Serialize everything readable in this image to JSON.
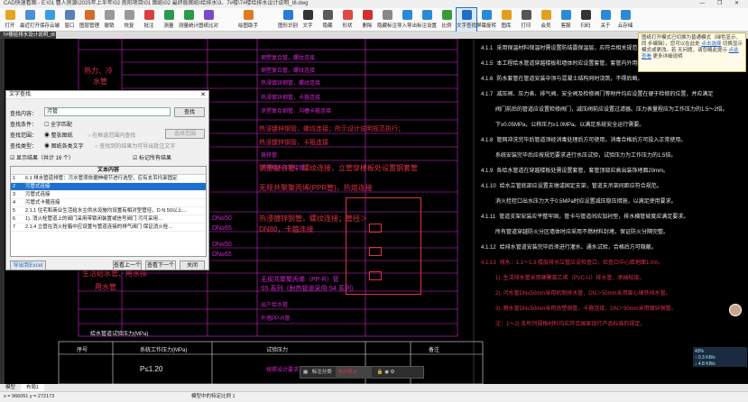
{
  "window": {
    "title": "CAD快速看图 - E:\\01 曹人房源\\2025年上半年\\02 南阳项目\\01 图纸\\02 最终版图纸\\给排水\\3、7#楼\\7#楼给排水设计说明_t8.dwg",
    "controls": "— ❐ ✕"
  },
  "ribbon": {
    "items": [
      {
        "label": "打开",
        "icon": "open-folder-icon",
        "color": "#e6a422"
      },
      {
        "label": "最近打开",
        "icon": "recent-icon",
        "color": "#4a8fd8"
      },
      {
        "label": "保存云端",
        "icon": "cloud-save-icon",
        "color": "#3a9de0"
      },
      {
        "label": "窗口",
        "icon": "window-icon",
        "color": "#5a7fb8"
      },
      {
        "label": "图层管理",
        "icon": "layers-icon",
        "color": "#d66a2a"
      },
      {
        "label": "撤销",
        "icon": "undo-icon",
        "color": "#999999"
      },
      {
        "label": "恢复",
        "icon": "redo-icon",
        "color": "#999999"
      },
      {
        "label": "批注",
        "icon": "annotate-icon",
        "color": "#d84040"
      },
      {
        "label": "测量",
        "icon": "measure-icon",
        "color": "#2b9a4a"
      },
      {
        "label": "测量统计",
        "icon": "measure-stat-icon",
        "color": "#2b9a4a"
      },
      {
        "label": "图纸比对",
        "icon": "compare-icon",
        "color": "#7a4ac8"
      },
      {
        "label": "",
        "icon": "",
        "color": "#fafafa"
      },
      {
        "label": "绘图助手",
        "icon": "draw-helper-icon",
        "color": "#e07a20"
      },
      {
        "label": "",
        "icon": "",
        "color": "#fafafa"
      },
      {
        "label": "图形识别",
        "icon": "recognize-icon",
        "color": "#2a7ad8"
      },
      {
        "label": "文字",
        "icon": "text-icon",
        "color": "#333333"
      },
      {
        "label": "隐藏",
        "icon": "hide-icon",
        "color": "#5a5a5a"
      },
      {
        "label": "形状",
        "icon": "shape-icon",
        "color": "#e04848"
      },
      {
        "label": "删除",
        "icon": "delete-icon",
        "color": "#d03030"
      },
      {
        "label": "隐藏标注",
        "icon": "hide-mark-icon",
        "color": "#888888"
      },
      {
        "label": "导入导出",
        "icon": "import-export-icon",
        "color": "#2a8ad8"
      },
      {
        "label": "标注设置",
        "icon": "mark-settings-icon",
        "color": "#2a8ad8"
      },
      {
        "label": "比例",
        "icon": "scale-icon",
        "color": "#3a9a3a"
      },
      {
        "label": "文字查找",
        "icon": "text-search-icon",
        "color": "#1e6ec8"
      },
      {
        "label": "屏幕旋转",
        "icon": "rotate-icon",
        "color": "#2a8ad8"
      },
      {
        "label": "图库",
        "icon": "library-icon",
        "color": "#e0a020"
      },
      {
        "label": "打印",
        "icon": "print-icon",
        "color": "#555555"
      },
      {
        "label": "会员",
        "icon": "vip-icon",
        "color": "#e0a020"
      },
      {
        "label": "客服",
        "icon": "service-icon",
        "color": "#2a8ad8"
      },
      {
        "label": "扫码",
        "icon": "qr-icon",
        "color": "#333333"
      },
      {
        "label": "关于",
        "icon": "about-icon",
        "color": "#2a8ad8"
      },
      {
        "label": "云存储",
        "icon": "cloud-icon",
        "color": "#2a8ad8"
      }
    ]
  },
  "doc_tab": "7#楼给排水设计说明_t8",
  "tooltip": {
    "line1": "图纸打开模式已切换为普通模式（绿色显示、同",
    "line2": "步编辑），您可以在此处",
    "link1": "点击选择",
    "line3": "切换显示模式或更改。若",
    "line4": "无问题，请忽略此提示",
    "link2": "点此查看",
    "line5": "更多详细说明"
  },
  "dialog": {
    "title": "文字查找",
    "search_label": "查找内容：",
    "search_value": "污管",
    "search_button": "查找",
    "condition_label": "查找条件：",
    "whole_match": "全字匹配",
    "scope_label": "查找范围：",
    "scope_all": "整张图纸",
    "scope_select": "在框选范围内查找",
    "scope_select_btn": "选择范围",
    "type_label": "查找类型：",
    "type_all": "图纸各类文字",
    "type_mark": "查找到的结果为可导出批注文字",
    "show_results": "显示结果（共计 16 个）",
    "mark_all": "标记所有结果",
    "table_header": "文本内容",
    "results": [
      {
        "n": "1",
        "text": "6.1  排水管道排管：污水管须依据伸缩节进行选型，应有支吊托架固定"
      },
      {
        "n": "2",
        "text": "污管式连接"
      },
      {
        "n": "3",
        "text": "污管式连接"
      },
      {
        "n": "4",
        "text": "污管式卡箍连接"
      },
      {
        "n": "5",
        "text": "2.1.1  住宅和商业生活给水主供水设施均设置有相对型管径，D N 50以上…"
      },
      {
        "n": "6",
        "text": "1).  消火栓管道上的阀门采用带锁闭装置或信号阀门 污可采用…"
      },
      {
        "n": "7",
        "text": "2.1.4  立管在消火栓箱中应设置与管道连接的排气阀门 保证消火栓…"
      }
    ],
    "export_btn": "导出到Excel",
    "prev_btn": "查看上一个",
    "next_btn": "查看下一个",
    "close_btn": "关闭"
  },
  "cad": {
    "header_tag": "卫生间",
    "left_texts": [
      {
        "t": "热力、冷",
        "c": "red"
      },
      {
        "t": "水管",
        "c": "red"
      },
      {
        "t": "区域",
        "c": "red"
      },
      {
        "t": "生活给水管、用水排",
        "c": "red"
      },
      {
        "t": "用水管",
        "c": "red"
      }
    ],
    "mid_texts": [
      "钢塑复合管，螺纹连接",
      "钢塑复合管，螺纹连接",
      "热浸镀锌钢管，螺纹连接",
      "热浸镀锌钢管，卡箍连接",
      "涂塑复合钢管、沟槽卡箍连接",
      "DN≤50",
      "DN≥65",
      "DN≤50",
      "DN≥65",
      "无规共聚聚丙烯（PP-R）管",
      "S5 系列（耐热管道采用 S4 系列）",
      "出户给水管",
      "外墙PP-R管",
      "铸铁管",
      "不锈钢卡压连接管"
    ],
    "red_rows": [
      "热浸镀锌钢管，螺纹连接；所示设计说明规范执行；",
      "热浸镀锌钢管，卡箍连接",
      "钢塑复合管，螺纹连接，立管穿楼板处设置钢套管",
      "无规共聚聚丙烯(PPR管)，热熔连接",
      "热浸镀锌钢管，螺纹连接；管径＞",
      "DN80，卡箍连接"
    ],
    "right_paragraphs": [
      {
        "n": "4.1.1",
        "t": "采用保温材料保温时需设置防结露保温层，应符合相关规范要求。"
      },
      {
        "n": "4.1.5",
        "t": "本工程给水管道穿越楼板和墙体时应设置套管，套管内外用防火材料封堵。"
      },
      {
        "n": "4.1.6",
        "t": "防水套管在管道安装中须与混凝土结构同时浇筑，不得后凿。"
      },
      {
        "n": "4.1.7",
        "t": "减压阀、压力表、排气阀、安全阀及检修阀门等附件均应设置在便于检修的位置，并应满足"
      },
      {
        "n": "",
        "t": "阀门前后的管道应设置检修阀门，减压阀前应设置过滤器。压力表量程应为工作压力的1.5～2倍。"
      },
      {
        "n": "",
        "t": "下≥0.05MPa，公称压力≥1.0MPa。以满足系统安全运行需要。"
      },
      {
        "n": "4.1.8",
        "t": "管网冲洗完毕后管道须经消毒处理后方可使用，消毒合格后方可投入正常使用。"
      },
      {
        "n": "",
        "t": "系统安装完毕后应按规范要求进行水压试验，试验压力为工作压力的1.5倍。"
      },
      {
        "n": "4.1.9",
        "t": "各给水管道在穿越楼板处需设置套管，套管顶部应高出装饰地面20mm。"
      },
      {
        "n": "4.1.10",
        "t": "给水立管底部应设置支墩或固定支架，管道支吊架间距应符合规范。"
      },
      {
        "n": "",
        "t": "消火栓栓口出水压力大于0.5MPa时应设置减压稳压措施，以满足使用要求。"
      },
      {
        "n": "4.1.11",
        "t": "管道支架安装应平整牢固，管卡与管道间应加衬垫，排水横管坡度应满足要求。"
      },
      {
        "n": "",
        "t": "所有管道穿越防火分区墙体时应采用不燃材料封堵，保证防火分隔完整。"
      },
      {
        "n": "4.1.12",
        "t": "给排水管道安装完毕后须进行灌水、通水试验，合格后方可隐蔽。"
      },
      {
        "n": "4.1.13",
        "t": "排水：1.1～1.3 楼层排水立管应设检查口，检查口中心距地面1.0m。"
      },
      {
        "n": "",
        "t": "1). 生活排水管采用硬聚氯乙烯（PVC-U）排水管，承插粘接。"
      },
      {
        "n": "",
        "t": "2). 污水管DN≤50mm采用机制排水管，DN＞50mm采用离心铸铁排水管。"
      },
      {
        "n": "",
        "t": "3). 雨水管DN≤50mm采用涂塑钢管，卡箍连接，DN＞50mm采用镀锌钢管。"
      },
      {
        "n": "",
        "t": "注：1～2) 条所列规格材料均应符合国家现行产品标准的规定。"
      }
    ],
    "bottom_title": "给水管道试验压力(MPa)",
    "bottom_header": [
      "序号",
      "系统工作压力(MPa)",
      "试验压力",
      "备注"
    ],
    "bottom_row": [
      "",
      "P≤1.20",
      "按照设计要求进行强度试验",
      ""
    ]
  },
  "floatbar": {
    "label": "标注分类",
    "value": "未分类"
  },
  "netmon": {
    "pct": "43%",
    "up": "↑ 0.3 KB/s",
    "down": "↓ 4.8 KB/s"
  },
  "bottom_tabs": [
    "模型",
    "布局1"
  ],
  "statusbar": {
    "coords": "x = 966051  y = 272173",
    "hint": "模型中的特定比例 1"
  }
}
